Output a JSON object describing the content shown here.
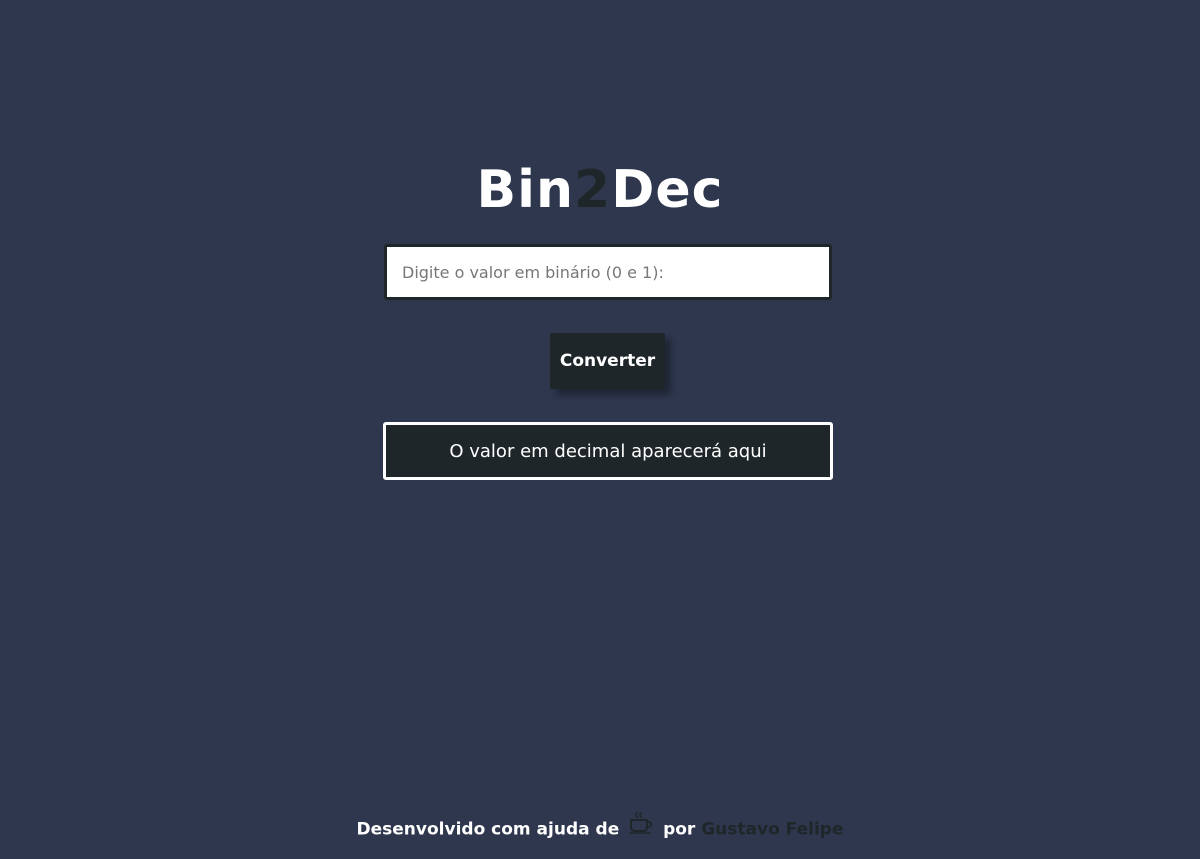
{
  "header": {
    "title_part1": "Bin",
    "title_accent": "2",
    "title_part2": "Dec"
  },
  "converter": {
    "input_placeholder": "Digite o valor em binário (0 e 1):",
    "input_value": "",
    "button_label": "Converter",
    "result_text": "O valor em decimal aparecerá aqui"
  },
  "footer": {
    "text_before": "Desenvolvido com ajuda de",
    "icon": "coffee-icon",
    "text_middle": "por",
    "author_name": "Gustavo Felipe"
  },
  "colors": {
    "background": "#2e374d",
    "dark": "#1f2629",
    "light": "#ffffff"
  }
}
